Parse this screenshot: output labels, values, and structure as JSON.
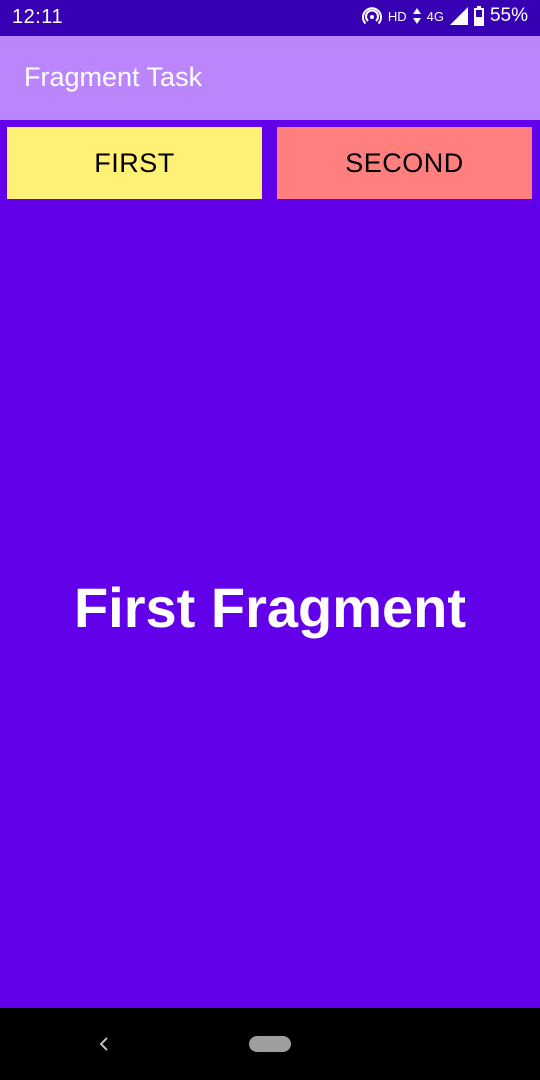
{
  "status_bar": {
    "time": "12:11",
    "hd_label": "HD",
    "network_label": "4G",
    "battery": "55%"
  },
  "app_bar": {
    "title": "Fragment Task"
  },
  "buttons": {
    "first_label": "FIRST",
    "second_label": "SECOND"
  },
  "fragment": {
    "text": "First Fragment"
  },
  "colors": {
    "status_bar": "#3700b3",
    "app_bar": "#bb86fc",
    "background": "#6200ea",
    "first_button": "#fff176",
    "second_button": "#ff7f7f"
  },
  "icons": {
    "hotspot": "hotspot-icon",
    "data_arrows": "data-arrows-icon",
    "signal": "signal-icon",
    "battery": "battery-icon",
    "back": "back-icon",
    "home": "home-pill-icon"
  }
}
